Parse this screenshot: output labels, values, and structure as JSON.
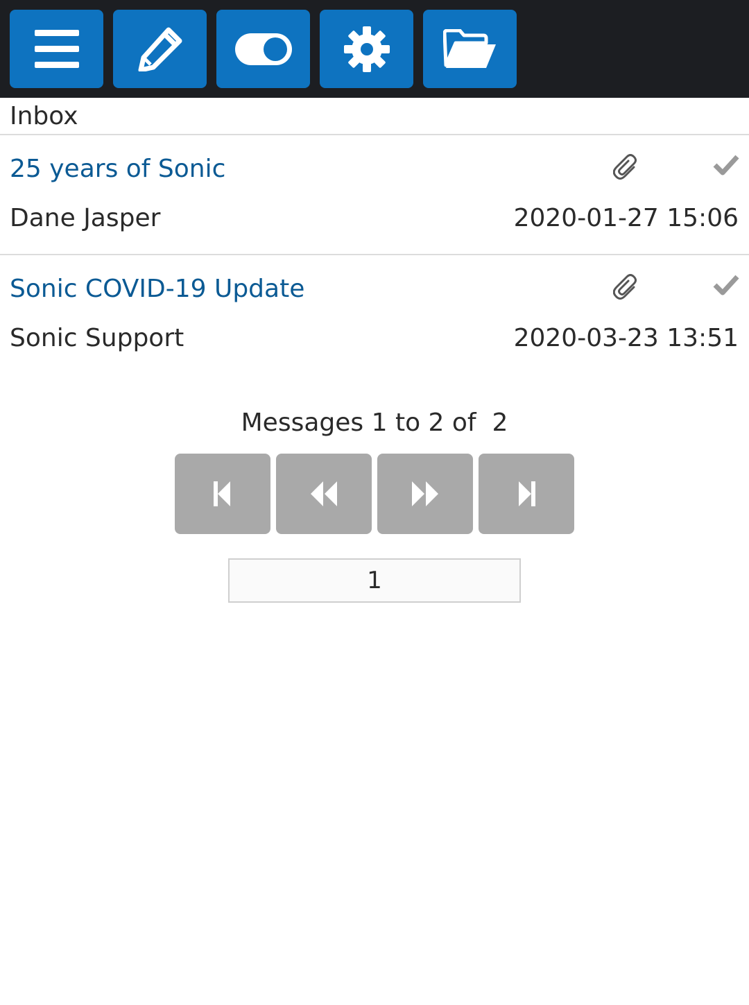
{
  "toolbar": {
    "buttons": [
      {
        "icon": "menu-icon"
      },
      {
        "icon": "pencil-icon"
      },
      {
        "icon": "toggle-icon"
      },
      {
        "icon": "gear-icon"
      },
      {
        "icon": "folder-open-icon"
      }
    ],
    "button_color": "#0e73c0",
    "background_color": "#1c1e22"
  },
  "folder": {
    "title": "Inbox"
  },
  "messages": [
    {
      "subject": "25 years of Sonic",
      "sender": "Dane Jasper",
      "date": "2020-01-27 15:06",
      "has_attachment": true,
      "read": true
    },
    {
      "subject": "Sonic COVID-19 Update",
      "sender": "Sonic Support",
      "date": "2020-03-23 13:51",
      "has_attachment": true,
      "read": true
    }
  ],
  "pager": {
    "summary": "Messages 1 to 2 of  2",
    "buttons": [
      {
        "icon": "first-page-icon"
      },
      {
        "icon": "previous-page-icon"
      },
      {
        "icon": "next-page-icon"
      },
      {
        "icon": "last-page-icon"
      }
    ],
    "page_value": "1"
  },
  "colors": {
    "subject_link": "#0b5a94",
    "pager_button": "#a9a9a9"
  }
}
